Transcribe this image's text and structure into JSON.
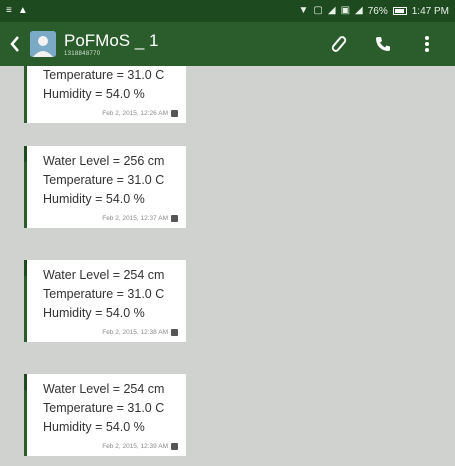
{
  "status_bar": {
    "left_icons": [
      "menu-lines-icon",
      "warning-icon"
    ],
    "battery": "76%",
    "time": "1:47 PM"
  },
  "toolbar": {
    "contact_name": "PoFMoS _ 1",
    "contact_number": "1318848770"
  },
  "messages": [
    {
      "lines": [
        "Temperature = 31.0 C",
        "Humidity = 54.0 %"
      ],
      "timestamp": "Feb 2, 2015, 12:26 AM"
    },
    {
      "lines": [
        "Water Level = 256 cm",
        "Temperature = 31.0 C",
        "Humidity = 54.0 %"
      ],
      "timestamp": "Feb 2, 2015, 12:37 AM"
    },
    {
      "lines": [
        "Water Level = 254 cm",
        "Temperature = 31.0 C",
        "Humidity = 54.0 %"
      ],
      "timestamp": "Feb 2, 2015, 12:38 AM"
    },
    {
      "lines": [
        "Water Level = 254 cm",
        "Temperature = 31.0 C",
        "Humidity = 54.0 %"
      ],
      "timestamp": "Feb 2, 2015, 12:39 AM"
    }
  ],
  "colors": {
    "status_bar": "#1e4a1f",
    "toolbar": "#2b5d2c",
    "background": "#cfd2cf",
    "bubble": "#ffffff"
  }
}
